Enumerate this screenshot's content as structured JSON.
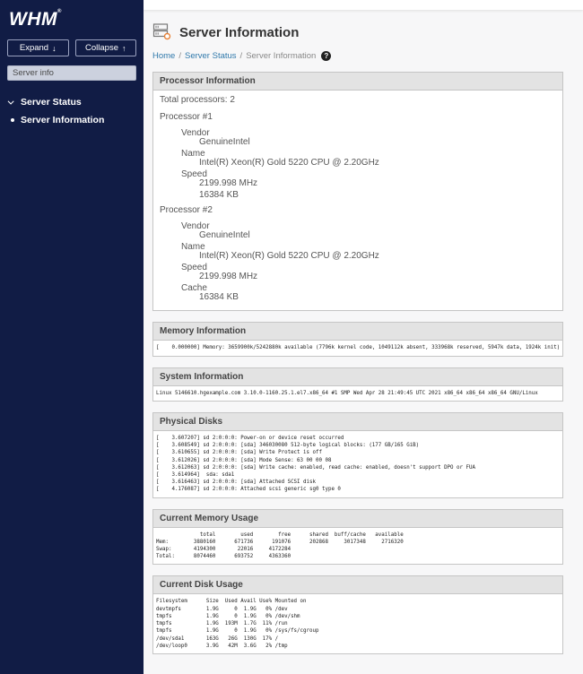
{
  "app": {
    "logo_text": "WHM",
    "registered_mark": "®"
  },
  "sidebar": {
    "expand_button": {
      "label": "Expand",
      "icon": "↓"
    },
    "collapse_button": {
      "label": "Collapse",
      "icon": "↑"
    },
    "search": {
      "placeholder": "Server info"
    },
    "nav": [
      {
        "label": "Server Status"
      },
      {
        "label": "Server Information",
        "active": true
      }
    ]
  },
  "header": {
    "title": "Server Information",
    "breadcrumb": {
      "items": [
        {
          "label": "Home"
        },
        {
          "label": "Server Status"
        },
        {
          "label": "Server Information"
        }
      ],
      "separator": "/"
    },
    "help_icon": "?"
  },
  "sections": {
    "processor": {
      "title": "Processor Information",
      "total_processors": "Total processors: 2",
      "processors": [
        {
          "name": "Processor #1",
          "specs": [
            {
              "label": "Vendor",
              "value": "GenuineIntel"
            },
            {
              "label": "Name",
              "value": "Intel(R) Xeon(R) Gold 5220 CPU @ 2.20GHz"
            },
            {
              "label": "Speed",
              "value": "2199.998 MHz"
            },
            {
              "label": "",
              "value": "16384 KB"
            }
          ]
        },
        {
          "name": "Processor #2",
          "specs": [
            {
              "label": "Vendor",
              "value": "GenuineIntel"
            },
            {
              "label": "Name",
              "value": "Intel(R) Xeon(R) Gold 5220 CPU @ 2.20GHz"
            },
            {
              "label": "Speed",
              "value": "2199.998 MHz"
            },
            {
              "label": "Cache",
              "value": "16384 KB"
            }
          ]
        }
      ]
    },
    "memory_information": {
      "title": "Memory Information",
      "output": "[    0.000000] Memory: 3659900k/5242880k available (7796k kernel code, 1049112k absent, 333968k reserved, 5947k data, 1924k init)"
    },
    "system_information": {
      "title": "System Information",
      "output": "Linux 5146610.hgexample.com 3.10.0-1160.25.1.el7.x86_64 #1 SMP Wed Apr 28 21:49:45 UTC 2021 x86_64 x86_64 x86_64 GNU/Linux"
    },
    "physical_disks": {
      "title": "Physical Disks",
      "output": "[    3.607207] sd 2:0:0:0: Power-on or device reset occurred\n[    3.608549] sd 2:0:0:0: [sda] 346030080 512-byte logical blocks: (177 GB/165 GiB)\n[    3.610655] sd 2:0:0:0: [sda] Write Protect is off\n[    3.612026] sd 2:0:0:0: [sda] Mode Sense: 63 00 00 08\n[    3.612063] sd 2:0:0:0: [sda] Write cache: enabled, read cache: enabled, doesn't support DPO or FUA\n[    3.614964]  sda: sda1\n[    3.616463] sd 2:0:0:0: [sda] Attached SCSI disk\n[    4.176087] sd 2:0:0:0: Attached scsi generic sg0 type 0"
    },
    "current_memory_usage": {
      "title": "Current Memory Usage",
      "output": "              total        used        free      shared  buff/cache   available\nMem:        3880160      671736      191076      202868     3017348     2716320\nSwap:       4194300       22016     4172284\nTotal:      8074460      693752     4363360"
    },
    "current_disk_usage": {
      "title": "Current Disk Usage",
      "output": "Filesystem      Size  Used Avail Use% Mounted on\ndevtmpfs        1.9G     0  1.9G   0% /dev\ntmpfs           1.9G     0  1.9G   0% /dev/shm\ntmpfs           1.9G  193M  1.7G  11% /run\ntmpfs           1.9G     0  1.9G   0% /sys/fs/cgroup\n/dev/sda1       163G   26G  130G  17% /\n/dev/loop0      3.9G   42M  3.6G   2% /tmp"
    }
  },
  "colors": {
    "sidebar_bg": "#111c45",
    "link_blue": "#3079ab",
    "section_header_bg": "#e3e3e3",
    "accent_orange": "#e8833a",
    "help_icon_bg": "#222222"
  }
}
